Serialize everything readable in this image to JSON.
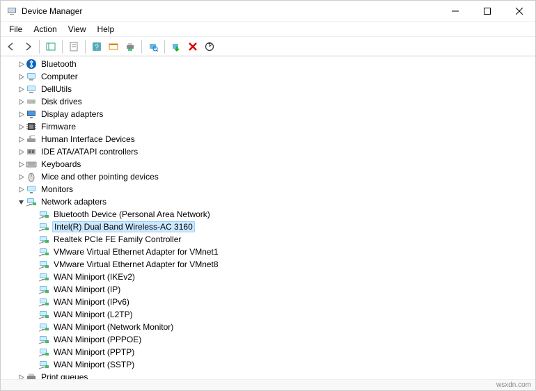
{
  "window": {
    "title": "Device Manager"
  },
  "menubar": {
    "items": [
      "File",
      "Action",
      "View",
      "Help"
    ]
  },
  "toolbar": {
    "icons": [
      "back",
      "forward",
      "sep",
      "show-hide",
      "sep",
      "properties",
      "sep",
      "help",
      "action-center",
      "print",
      "sep",
      "scan",
      "sep",
      "add",
      "remove",
      "update"
    ]
  },
  "tree": [
    {
      "label": "Bluetooth",
      "icon": "bluetooth",
      "expandable": true,
      "expanded": false,
      "depth": 1
    },
    {
      "label": "Computer",
      "icon": "computer",
      "expandable": true,
      "expanded": false,
      "depth": 1
    },
    {
      "label": "DellUtils",
      "icon": "computer",
      "expandable": true,
      "expanded": false,
      "depth": 1
    },
    {
      "label": "Disk drives",
      "icon": "disk",
      "expandable": true,
      "expanded": false,
      "depth": 1
    },
    {
      "label": "Display adapters",
      "icon": "display",
      "expandable": true,
      "expanded": false,
      "depth": 1
    },
    {
      "label": "Firmware",
      "icon": "firmware",
      "expandable": true,
      "expanded": false,
      "depth": 1
    },
    {
      "label": "Human Interface Devices",
      "icon": "hid",
      "expandable": true,
      "expanded": false,
      "depth": 1
    },
    {
      "label": "IDE ATA/ATAPI controllers",
      "icon": "ide",
      "expandable": true,
      "expanded": false,
      "depth": 1
    },
    {
      "label": "Keyboards",
      "icon": "keyboard",
      "expandable": true,
      "expanded": false,
      "depth": 1
    },
    {
      "label": "Mice and other pointing devices",
      "icon": "mouse",
      "expandable": true,
      "expanded": false,
      "depth": 1
    },
    {
      "label": "Monitors",
      "icon": "monitor",
      "expandable": true,
      "expanded": false,
      "depth": 1
    },
    {
      "label": "Network adapters",
      "icon": "network",
      "expandable": true,
      "expanded": true,
      "depth": 1
    },
    {
      "label": "Bluetooth Device (Personal Area Network)",
      "icon": "network",
      "expandable": false,
      "depth": 2
    },
    {
      "label": "Intel(R) Dual Band Wireless-AC 3160",
      "icon": "network",
      "expandable": false,
      "depth": 2,
      "selected": true
    },
    {
      "label": "Realtek PCIe FE Family Controller",
      "icon": "network",
      "expandable": false,
      "depth": 2
    },
    {
      "label": "VMware Virtual Ethernet Adapter for VMnet1",
      "icon": "network",
      "expandable": false,
      "depth": 2
    },
    {
      "label": "VMware Virtual Ethernet Adapter for VMnet8",
      "icon": "network",
      "expandable": false,
      "depth": 2
    },
    {
      "label": "WAN Miniport (IKEv2)",
      "icon": "network",
      "expandable": false,
      "depth": 2
    },
    {
      "label": "WAN Miniport (IP)",
      "icon": "network",
      "expandable": false,
      "depth": 2
    },
    {
      "label": "WAN Miniport (IPv6)",
      "icon": "network",
      "expandable": false,
      "depth": 2
    },
    {
      "label": "WAN Miniport (L2TP)",
      "icon": "network",
      "expandable": false,
      "depth": 2
    },
    {
      "label": "WAN Miniport (Network Monitor)",
      "icon": "network",
      "expandable": false,
      "depth": 2
    },
    {
      "label": "WAN Miniport (PPPOE)",
      "icon": "network",
      "expandable": false,
      "depth": 2
    },
    {
      "label": "WAN Miniport (PPTP)",
      "icon": "network",
      "expandable": false,
      "depth": 2
    },
    {
      "label": "WAN Miniport (SSTP)",
      "icon": "network",
      "expandable": false,
      "depth": 2
    },
    {
      "label": "Print queues",
      "icon": "printer",
      "expandable": true,
      "expanded": false,
      "depth": 1
    }
  ],
  "footer": {
    "watermark": "wsxdn.com"
  },
  "icons": {
    "bluetooth": "bt",
    "computer": "pc",
    "disk": "disk",
    "display": "disp",
    "firmware": "fw",
    "hid": "hid",
    "ide": "ide",
    "keyboard": "kb",
    "mouse": "mouse",
    "monitor": "mon",
    "network": "net",
    "printer": "prn"
  }
}
